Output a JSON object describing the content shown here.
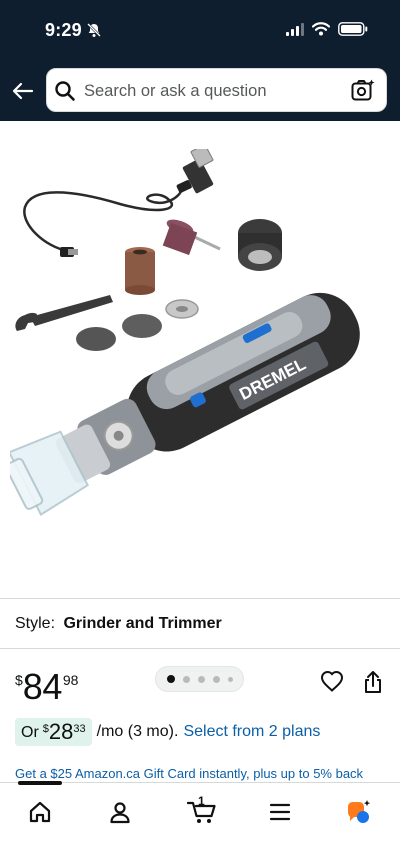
{
  "status_bar": {
    "time": "9:29"
  },
  "search": {
    "placeholder": "Search or ask a question"
  },
  "product": {
    "brand_text": "DREMEL",
    "image_dots": 5,
    "active_image": 1
  },
  "style": {
    "label": "Style:",
    "value": "Grinder and Trimmer"
  },
  "price": {
    "symbol": "$",
    "whole": "84",
    "fraction": "98"
  },
  "plan": {
    "or": "Or",
    "symbol": "$",
    "whole": "28",
    "fraction": "33",
    "term": "/mo (3 mo).",
    "link": "Select from 2 plans"
  },
  "promo": "Get a $25 Amazon.ca Gift Card instantly, plus up to 5% back",
  "nav": {
    "cart_count": "1"
  },
  "colors": {
    "header_bg": "#0f1e2f",
    "link": "#0b5fa6",
    "plan_pill": "#dff2ec",
    "tool_accent": "#1f6fd1"
  }
}
